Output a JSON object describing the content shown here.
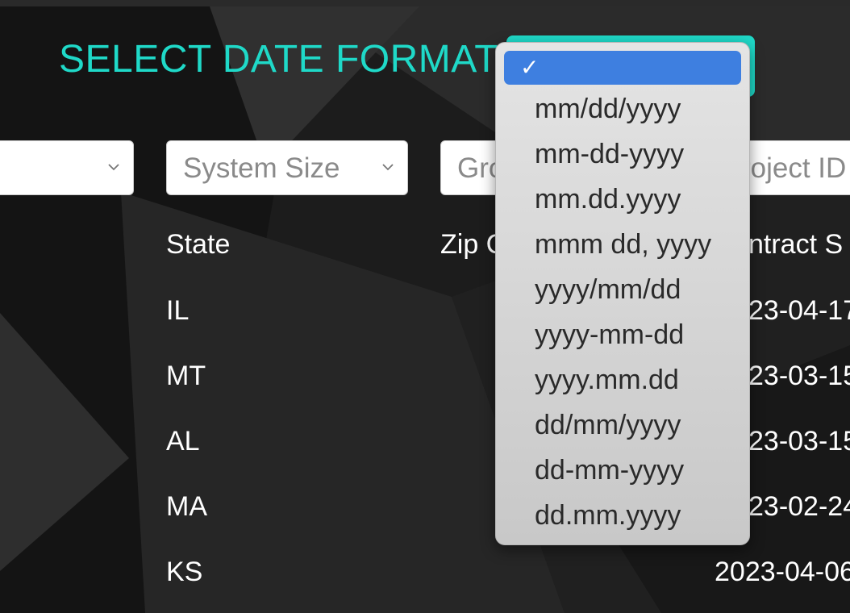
{
  "date_format": {
    "label": "SELECT DATE FORMAT:",
    "accent_color": "#1fd9c8",
    "dropdown": {
      "selected_mark": "✓",
      "selected_value": "",
      "options": [
        "mm/dd/yyyy",
        "mm-dd-yyyy",
        "mm.dd.yyyy",
        "mmm dd, yyyy",
        "yyyy/mm/dd",
        "yyyy-mm-dd",
        "yyyy.mm.dd",
        "dd/mm/yyyy",
        "dd-mm-yyyy",
        "dd.mm.yyyy"
      ],
      "highlight_color": "#3e7fe0"
    }
  },
  "filters": [
    {
      "label": ""
    },
    {
      "label": "System Size"
    },
    {
      "label": "Gro"
    },
    {
      "label": "roject ID"
    }
  ],
  "table": {
    "headers": [
      "State",
      "Zip C",
      "ntract S"
    ],
    "rows": [
      {
        "state": "IL",
        "contract": "23-04-17"
      },
      {
        "state": "MT",
        "contract": "23-03-15"
      },
      {
        "state": "AL",
        "contract": "23-03-15"
      },
      {
        "state": "MA",
        "contract": "23-02-24"
      },
      {
        "state": "KS",
        "contract": "2023-04-06"
      }
    ]
  }
}
